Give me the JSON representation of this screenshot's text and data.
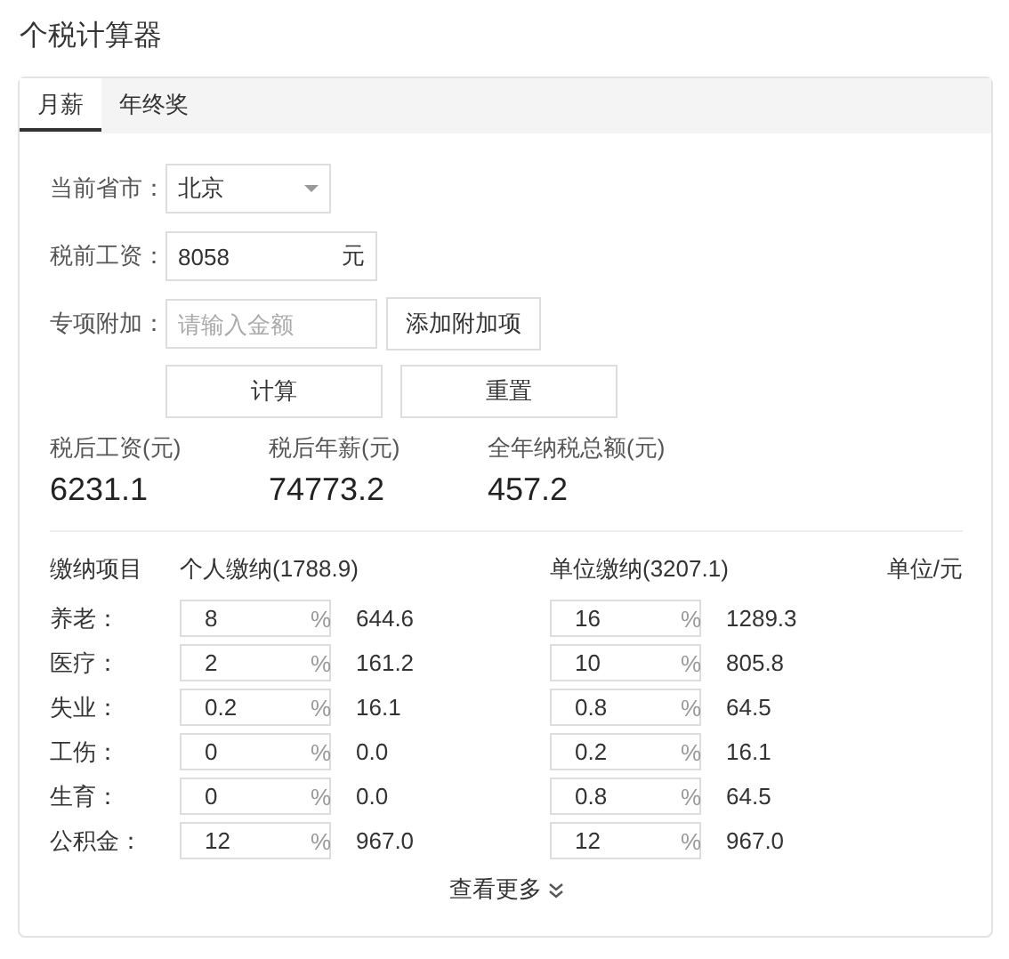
{
  "title": "个税计算器",
  "tabs": [
    {
      "label": "月薪",
      "selected": true
    },
    {
      "label": "年终奖",
      "selected": false
    }
  ],
  "form": {
    "city": {
      "label": "当前省市：",
      "value": "北京"
    },
    "salary": {
      "label": "税前工资：",
      "value": "8058",
      "unit": "元"
    },
    "special": {
      "label": "专项附加：",
      "placeholder": "请输入金额",
      "button": "添加附加项"
    },
    "buttons": [
      "计算",
      "重置"
    ]
  },
  "results": [
    {
      "label": "税后工资(元)",
      "value": "6231.1"
    },
    {
      "label": "税后年薪(元)",
      "value": "74773.2"
    },
    {
      "label": "全年纳税总额(元)",
      "value": "457.2"
    }
  ],
  "table": {
    "columns": [
      "缴纳项目",
      "个人缴纳(1788.9)",
      "单位缴纳(3207.1)",
      "单位/元"
    ],
    "rows": [
      {
        "label": "养老：",
        "personal_rate": "8",
        "personal_amount": "644.6",
        "company_rate": "16",
        "company_amount": "1289.3"
      },
      {
        "label": "医疗：",
        "personal_rate": "2",
        "personal_amount": "161.2",
        "company_rate": "10",
        "company_amount": "805.8"
      },
      {
        "label": "失业：",
        "personal_rate": "0.2",
        "personal_amount": "16.1",
        "company_rate": "0.8",
        "company_amount": "64.5"
      },
      {
        "label": "工伤：",
        "personal_rate": "0",
        "personal_amount": "0.0",
        "company_rate": "0.2",
        "company_amount": "16.1"
      },
      {
        "label": "生育：",
        "personal_rate": "0",
        "personal_amount": "0.0",
        "company_rate": "0.8",
        "company_amount": "64.5"
      },
      {
        "label": "公积金：",
        "personal_rate": "12",
        "personal_amount": "967.0",
        "company_rate": "12",
        "company_amount": "967.0"
      }
    ],
    "unit": "%"
  },
  "more_link": "查看更多"
}
